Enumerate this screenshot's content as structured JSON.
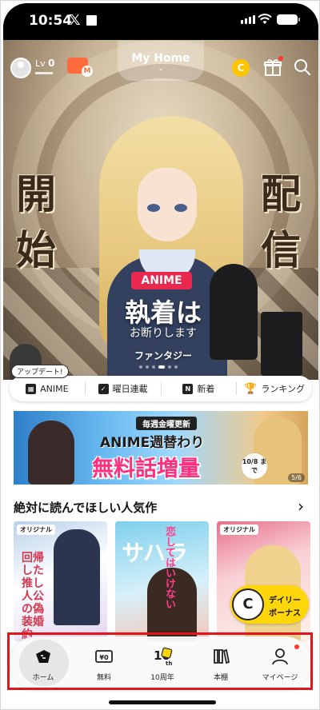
{
  "status_bar": {
    "time": "10:54",
    "x_logo": "𝕏"
  },
  "topbar": {
    "level_prefix": "Lv",
    "level_value": "0",
    "coin_badge_letter": "M",
    "title": "My Home",
    "title_chevron": "⌄",
    "coin_letter": "C"
  },
  "hero": {
    "chars_left": [
      "開",
      "始"
    ],
    "chars_right": [
      "配",
      "信"
    ],
    "tag": "ANIME",
    "title": "執着はお断りします",
    "title_main": "執着は",
    "title_sub": "お断りします",
    "genre": "ファンタジー",
    "page_dots": 6,
    "active_dot": 4
  },
  "categories": {
    "update_badge": "アップデート!",
    "items": [
      {
        "label": "ANIME",
        "icon": "film-icon"
      },
      {
        "label": "曜日連載",
        "icon": "calendar-icon"
      },
      {
        "label": "新着",
        "icon": "new-icon",
        "glyph": "N"
      },
      {
        "label": "ランキング",
        "icon": "trophy-icon"
      }
    ]
  },
  "banner": {
    "top": "毎週金曜更新",
    "middle": "ANIME週替わり",
    "big": "無料話増量",
    "date": "10/8 まで",
    "page": "5/6"
  },
  "section": {
    "title": "絶対に読んでほしい人気作",
    "arrow": "›",
    "cards": [
      {
        "badge": "オリジナル",
        "title": "回帰した推し人公の偽装婚約"
      },
      {
        "badge": "",
        "title": "サハラ",
        "subtitle": "恋してはいけない"
      },
      {
        "badge": "オリジナル",
        "title": ""
      }
    ]
  },
  "daily_bonus": {
    "badge": "C",
    "line1": "デイリー",
    "line2": "ボーナス"
  },
  "bottom_nav": [
    {
      "label": "ホーム",
      "icon": "home-icon",
      "active": true
    },
    {
      "label": "無料",
      "icon": "free-ticket-icon",
      "glyph": "¥0"
    },
    {
      "label": "10周年",
      "icon": "anniversary-10th-icon",
      "glyph": "10th"
    },
    {
      "label": "本棚",
      "icon": "bookshelf-icon"
    },
    {
      "label": "マイページ",
      "icon": "user-icon"
    }
  ],
  "colors": {
    "anime_tag": "#e8284e",
    "coin": "#ffc400",
    "daily_bonus": "#ffd60a",
    "highlight_frame": "#e0161b",
    "notification_dot": "#ff3b30"
  }
}
